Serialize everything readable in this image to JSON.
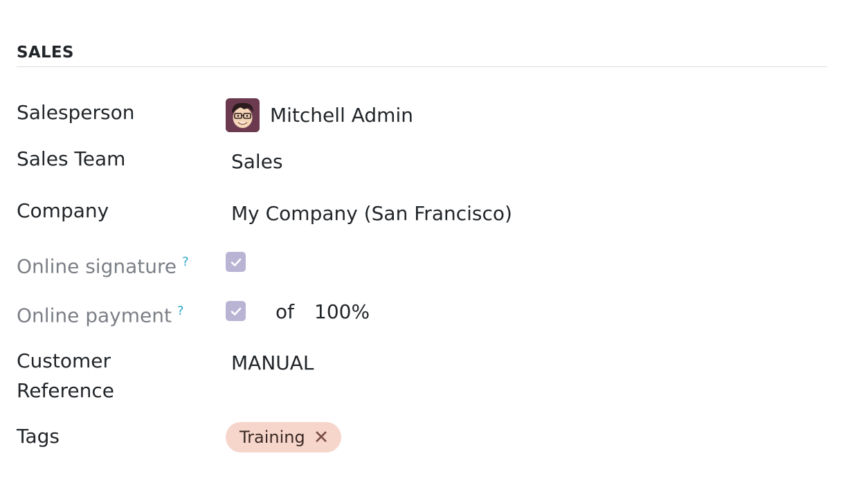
{
  "section": {
    "title": "SALES"
  },
  "fields": {
    "salesperson": {
      "label": "Salesperson",
      "value": "Mitchell Admin",
      "avatar_icon": "avatar-face-icon"
    },
    "sales_team": {
      "label": "Sales Team",
      "value": "Sales"
    },
    "company": {
      "label": "Company",
      "value": "My Company (San Francisco)"
    },
    "online_signature": {
      "label": "Online signature",
      "help": "?",
      "checked": true
    },
    "online_payment": {
      "label": "Online payment",
      "help": "?",
      "checked": true,
      "of_text": "of",
      "percent": "100%"
    },
    "customer_reference": {
      "label_line1": "Customer",
      "label_line2": "Reference",
      "value": "MANUAL"
    },
    "tags": {
      "label": "Tags",
      "items": [
        {
          "label": "Training",
          "remove": "✕",
          "color": "#f6d5cb"
        }
      ]
    }
  },
  "colors": {
    "checkbox": "#b9b3d4",
    "help": "#2aa6c8",
    "muted_label": "#7b7f86"
  }
}
